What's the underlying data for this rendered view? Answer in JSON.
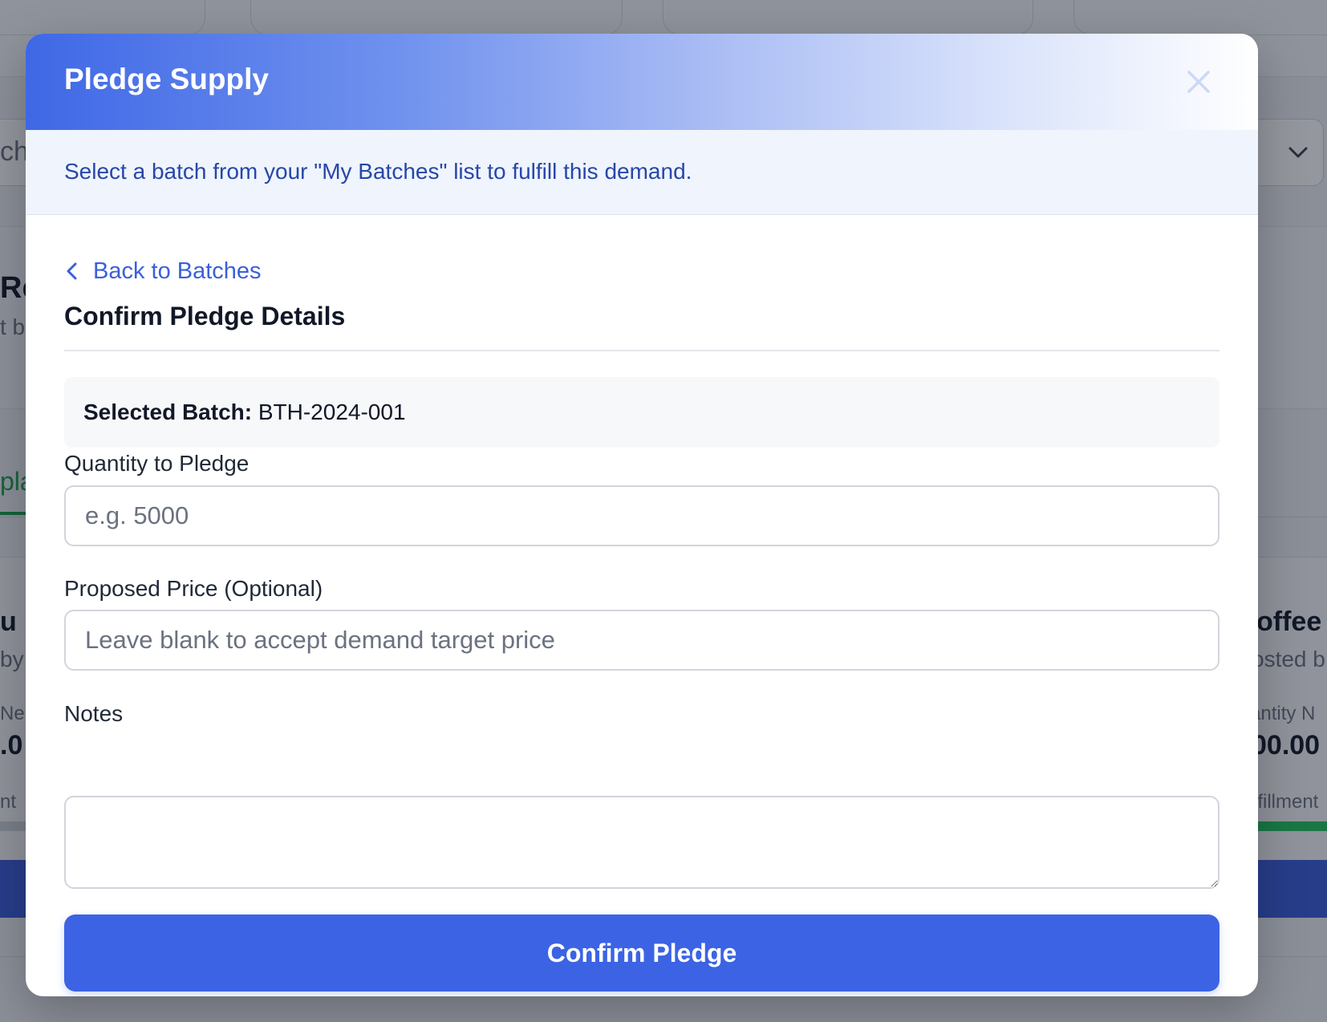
{
  "background": {
    "search_fragment": "ch",
    "heading_fragment": "Re",
    "subtext_fragment": "t b",
    "tab_fragment": "pla",
    "card_left": {
      "title_fragment": "u",
      "by_fragment": "by",
      "label_fragment": "Ne",
      "value_fragment": ".0",
      "footer_fragment": "nt"
    },
    "card_right": {
      "title_fragment": "offee",
      "by_fragment": "osted b",
      "label_fragment": "antity N",
      "value_fragment": "00.00",
      "footer_fragment": "lfillment"
    }
  },
  "modal": {
    "title": "Pledge Supply",
    "info_banner": "Select a batch from your \"My Batches\" list to fulfill this demand.",
    "back_link": "Back to Batches",
    "section_title": "Confirm Pledge Details",
    "selected_batch_label": "Selected Batch:",
    "selected_batch_value": "BTH-2024-001",
    "fields": {
      "quantity": {
        "label": "Quantity to Pledge",
        "value": "",
        "placeholder": "e.g. 5000"
      },
      "price": {
        "label": "Proposed Price (Optional)",
        "value": "",
        "placeholder": "Leave blank to accept demand target price"
      },
      "notes": {
        "label": "Notes",
        "value": "",
        "placeholder": ""
      }
    },
    "confirm_button": "Confirm Pledge"
  },
  "colors": {
    "primary": "#3b63e4",
    "header_gradient_start": "#3f68e6",
    "link": "#3b5fd9",
    "banner_text": "#2747a8",
    "banner_bg": "#eff4fd"
  },
  "icons": {
    "close": "close-icon",
    "back": "chevron-left-icon",
    "dropdown": "chevron-down-icon"
  }
}
